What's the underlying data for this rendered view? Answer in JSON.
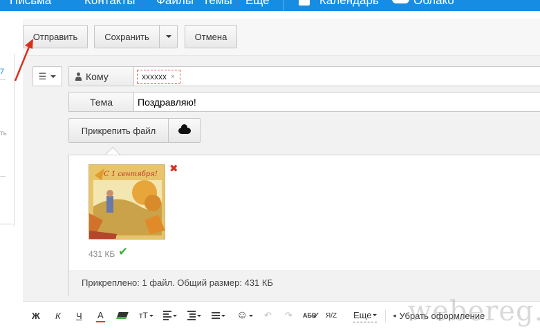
{
  "nav": {
    "items": [
      "Письма",
      "Контакты",
      "Файлы",
      "Темы",
      "Еще",
      "Календарь",
      "Облако"
    ]
  },
  "toolbar": {
    "send_label": "Отправить",
    "save_label": "Сохранить",
    "cancel_label": "Отмена"
  },
  "compose": {
    "to_label": "Кому",
    "recipient": "xxxxxx",
    "recipient_remove": "×",
    "subject_label": "Тема",
    "subject_value": "Поздравляю!",
    "attach_label": "Прикрепить файл"
  },
  "attachment": {
    "size": "431 КБ",
    "thumb_text": "С 1 сентября!",
    "summary": "Прикреплено: 1 файл. Общий размер: 431 КБ"
  },
  "format": {
    "bold": "Ж",
    "italic": "К",
    "underline": "Ч",
    "color": "А",
    "size": "тТ",
    "spell": "АБВ",
    "translit": "Я/Z",
    "more": "Еще",
    "clear": "Убрать оформление"
  },
  "watermark": "webereg.ru",
  "colors": {
    "nav_bg": "#168de2",
    "remove": "#d9301e",
    "check": "#3fb13b",
    "arrow": "#d9301e"
  },
  "icons": [
    "calendar-icon",
    "cloud-icon",
    "menu-icon",
    "person-icon",
    "remove-icon",
    "check-icon",
    "emoji-icon",
    "undo-icon",
    "redo-icon"
  ]
}
